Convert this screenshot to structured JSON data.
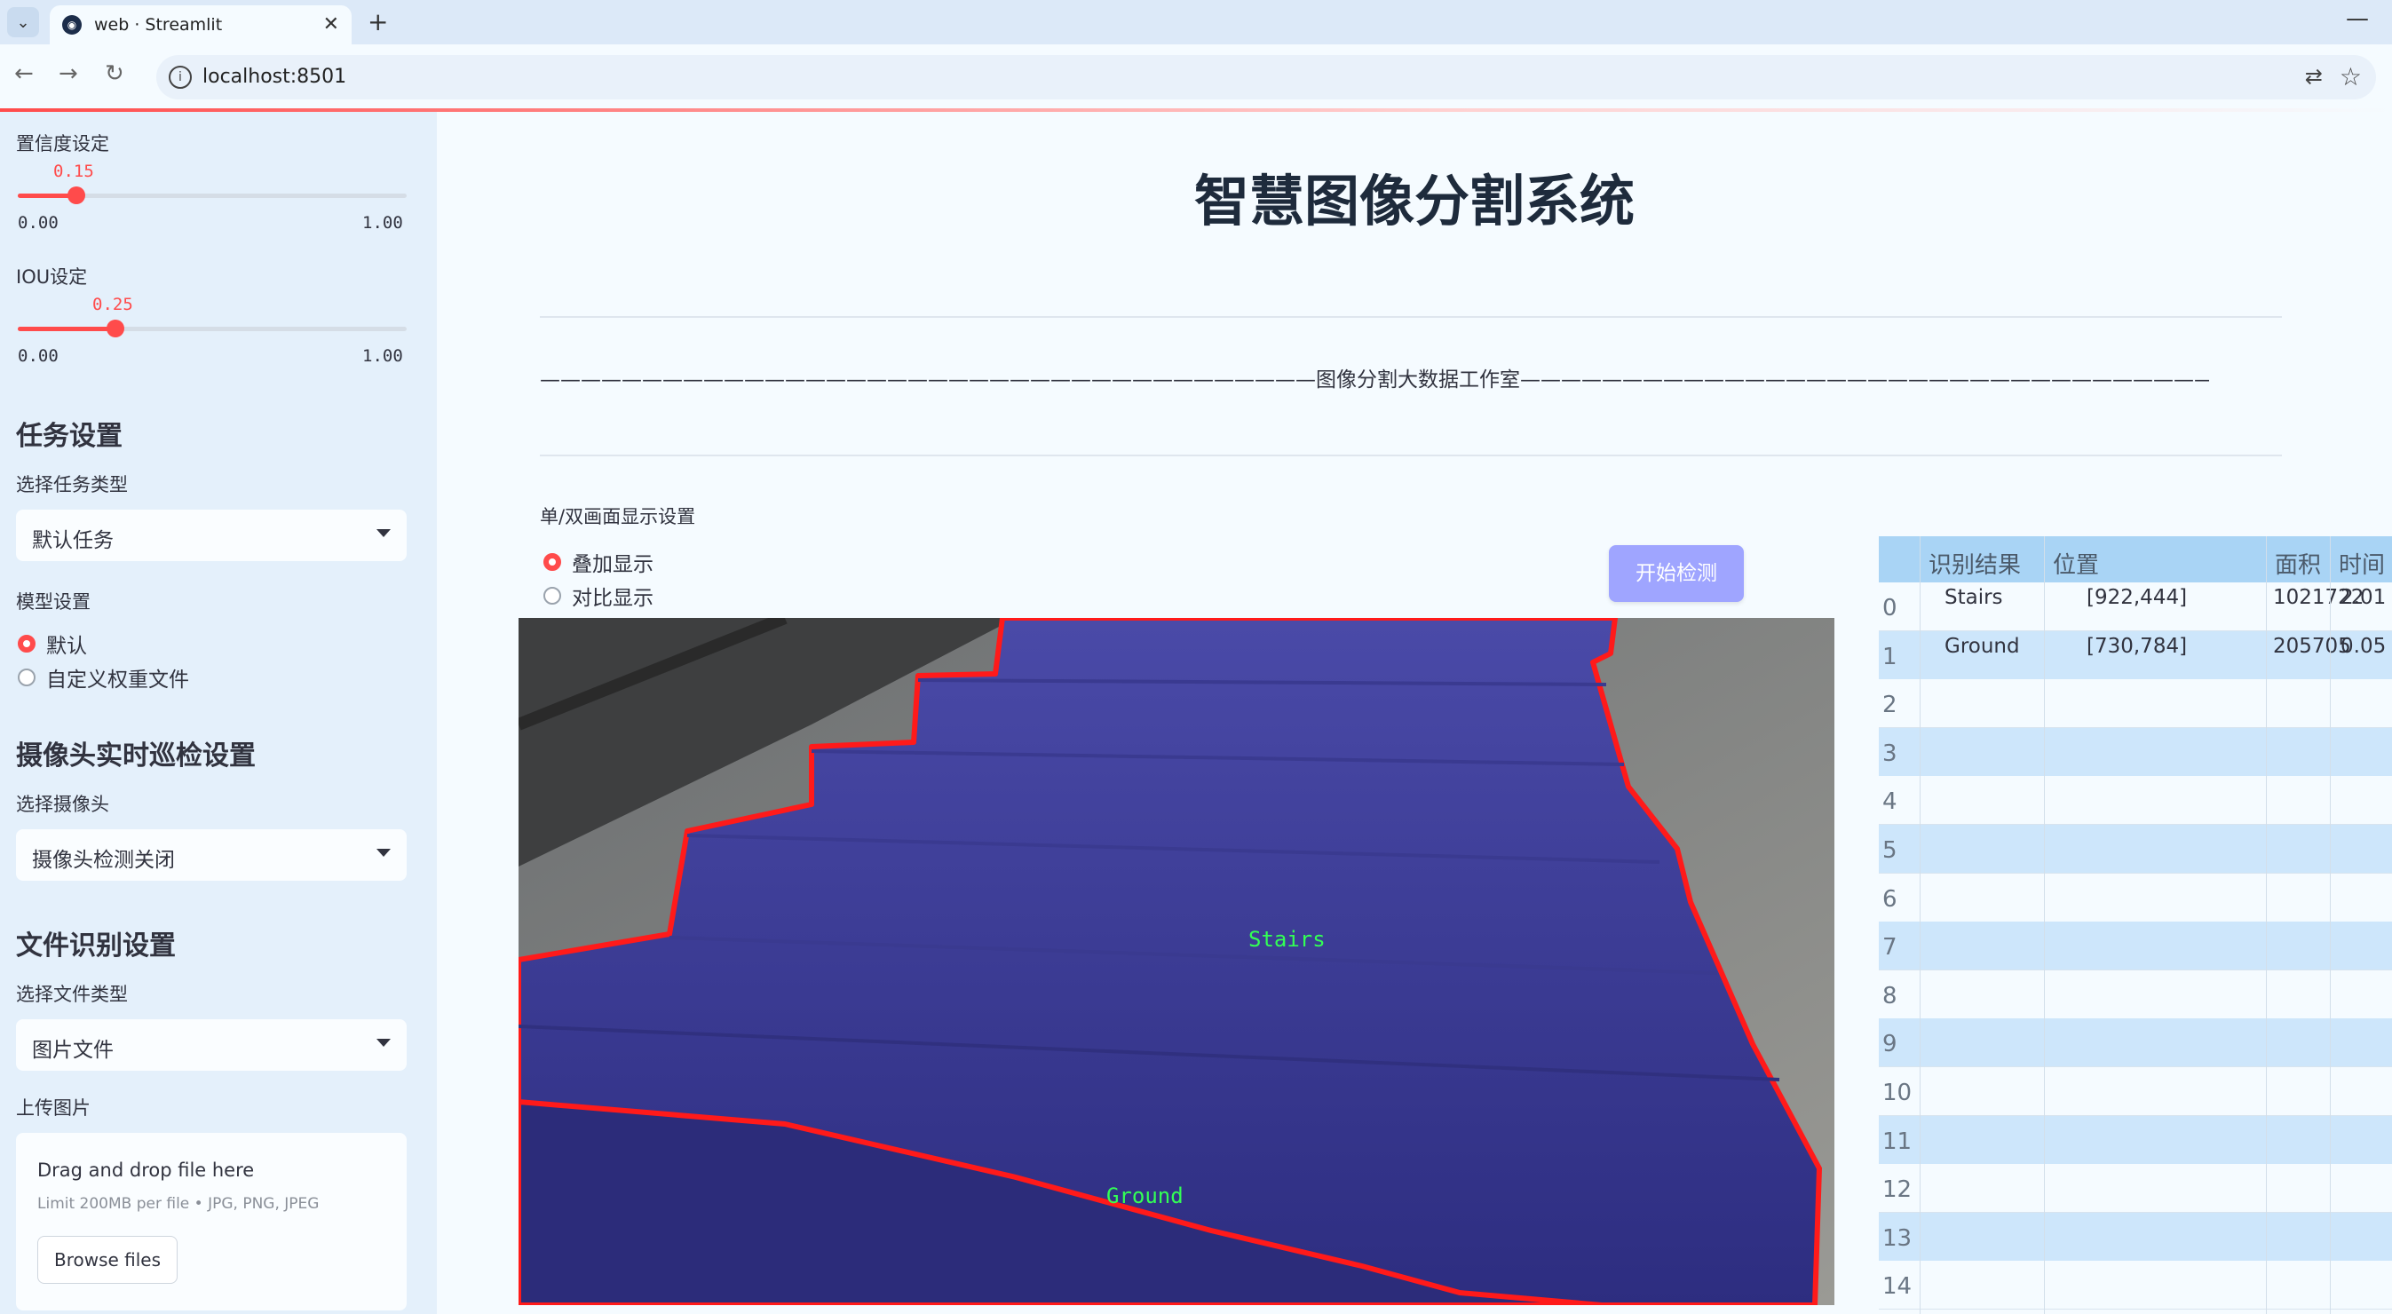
{
  "browser": {
    "tab_title": "web · Streamlit",
    "url": "localhost:8501"
  },
  "sidebar": {
    "confidence": {
      "label": "置信度设定",
      "value": "0.15",
      "min": "0.00",
      "max": "1.00",
      "fraction": 0.15
    },
    "iou": {
      "label": "IOU设定",
      "value": "0.25",
      "min": "0.00",
      "max": "1.00",
      "fraction": 0.25
    },
    "task_heading": "任务设置",
    "task_type_label": "选择任务类型",
    "task_type_value": "默认任务",
    "model_label": "模型设置",
    "model_options": [
      "默认",
      "自定义权重文件"
    ],
    "camera_heading": "摄像头实时巡检设置",
    "camera_label": "选择摄像头",
    "camera_value": "摄像头检测关闭",
    "file_heading": "文件识别设置",
    "file_type_label": "选择文件类型",
    "file_type_value": "图片文件",
    "upload_label": "上传图片",
    "dropzone_title": "Drag and drop file here",
    "dropzone_limit": "Limit 200MB per file • JPG, PNG, JPEG",
    "browse_label": "Browse files"
  },
  "main": {
    "title": "智慧图像分割系统",
    "studio_line": "——————————————————————————————————————图像分割大数据工作室——————————————————————————————————————",
    "display_label": "单/双画面显示设置",
    "display_options": [
      "叠加显示",
      "对比显示"
    ],
    "start_button": "开始检测",
    "image_labels": [
      "Stairs",
      "Ground"
    ]
  },
  "table": {
    "columns": [
      "识别结果",
      "位置",
      "面积",
      "时间"
    ],
    "rows": [
      {
        "index": "0",
        "result": "Stairs",
        "position": "[922,444]",
        "area": "1021722",
        "time": "2.01"
      },
      {
        "index": "1",
        "result": "Ground",
        "position": "[730,784]",
        "area": "205705",
        "time": "0.05"
      },
      {
        "index": "2"
      },
      {
        "index": "3"
      },
      {
        "index": "4"
      },
      {
        "index": "5"
      },
      {
        "index": "6"
      },
      {
        "index": "7"
      },
      {
        "index": "8"
      },
      {
        "index": "9"
      },
      {
        "index": "10"
      },
      {
        "index": "11"
      },
      {
        "index": "12"
      },
      {
        "index": "13"
      },
      {
        "index": "14"
      }
    ]
  },
  "colors": {
    "accent": "#ff4b4b",
    "button": "#9fa5ff",
    "mask": "#3a3a9a",
    "outline": "#ff1a1a",
    "label": "#33ff55"
  }
}
